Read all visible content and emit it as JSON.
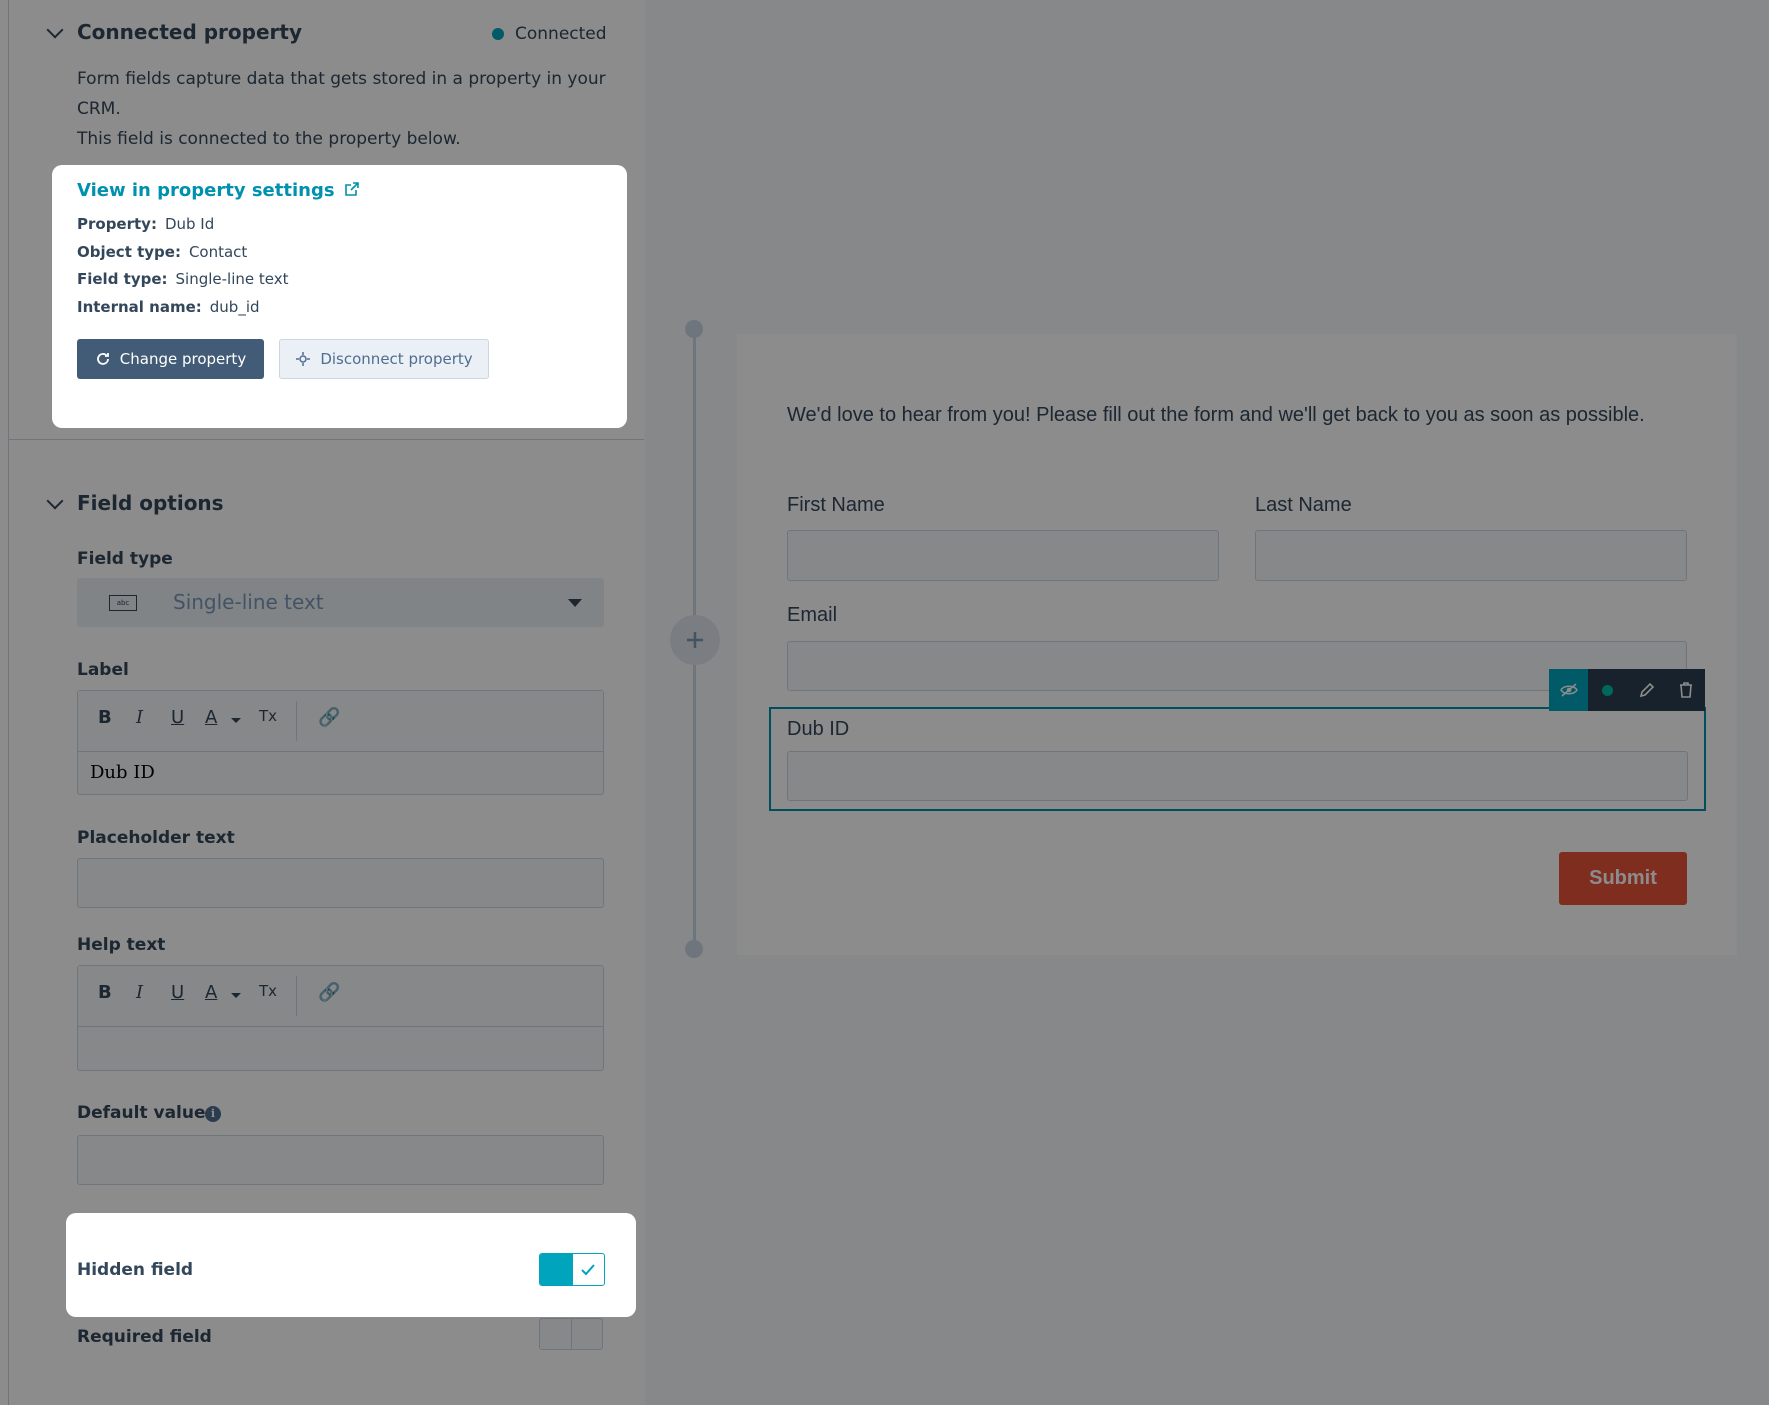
{
  "connected_property": {
    "title": "Connected property",
    "status": "Connected",
    "description_1": "Form fields capture data that gets stored in a property in your CRM.",
    "description_2": "This field is connected to the property below.",
    "card": {
      "link": "View in property settings",
      "rows": [
        {
          "key": "Property:",
          "value": "Dub Id"
        },
        {
          "key": "Object type:",
          "value": "Contact"
        },
        {
          "key": "Field type:",
          "value": "Single-line text"
        },
        {
          "key": "Internal name:",
          "value": "dub_id"
        }
      ],
      "change_button": "Change property",
      "disconnect_button": "Disconnect property"
    }
  },
  "field_options": {
    "title": "Field options",
    "field_type_label": "Field type",
    "field_type_value": "Single-line text",
    "field_type_icon_text": "abc",
    "label_label": "Label",
    "label_value": "Dub ID",
    "placeholder_label": "Placeholder text",
    "help_label": "Help text",
    "default_label": "Default value",
    "hidden_label": "Hidden field",
    "required_label": "Required field",
    "toolbar": {
      "bold": "B",
      "italic": "I",
      "underline": "U",
      "color": "A",
      "clear": "Tx"
    }
  },
  "form_preview": {
    "intro": "We'd love to hear from you! Please fill out the form and we'll get back to you as soon as possible.",
    "first_name": "First Name",
    "last_name": "Last Name",
    "email": "Email",
    "dub_id": "Dub ID",
    "submit": "Submit"
  },
  "colors": {
    "accent": "#0091ae",
    "primary_button": "#425b76",
    "submit": "#e8523a",
    "toggle_on": "#00a4bd"
  }
}
